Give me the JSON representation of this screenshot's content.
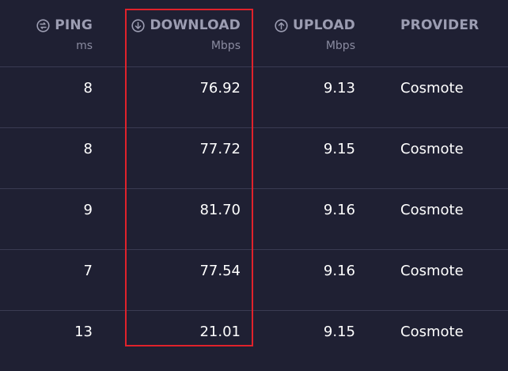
{
  "columns": {
    "ping": {
      "label": "PING",
      "unit": "ms",
      "icon": "ping-icon"
    },
    "download": {
      "label": "DOWNLOAD",
      "unit": "Mbps",
      "icon": "download-arrow-icon"
    },
    "upload": {
      "label": "UPLOAD",
      "unit": "Mbps",
      "icon": "upload-arrow-icon"
    },
    "provider": {
      "label": "PROVIDER"
    }
  },
  "rows": [
    {
      "ping": "8",
      "download": "76.92",
      "upload": "9.13",
      "provider": "Cosmote"
    },
    {
      "ping": "8",
      "download": "77.72",
      "upload": "9.15",
      "provider": "Cosmote"
    },
    {
      "ping": "9",
      "download": "81.70",
      "upload": "9.16",
      "provider": "Cosmote"
    },
    {
      "ping": "7",
      "download": "77.54",
      "upload": "9.16",
      "provider": "Cosmote"
    },
    {
      "ping": "13",
      "download": "21.01",
      "upload": "9.15",
      "provider": "Cosmote"
    }
  ],
  "colors": {
    "background": "#1f2033",
    "header_text": "#9c9db2",
    "divider": "#3a3b52",
    "highlight": "#e0222b"
  }
}
